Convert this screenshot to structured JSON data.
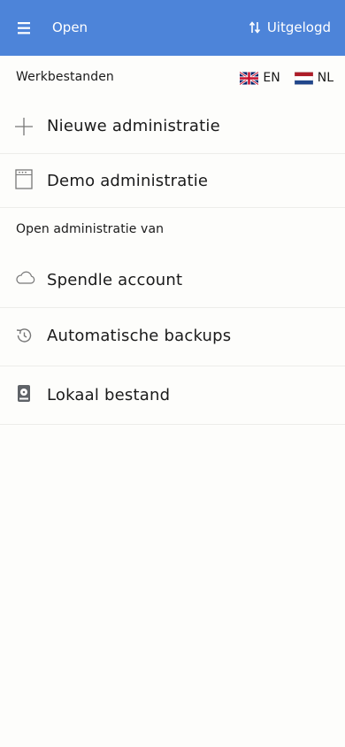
{
  "appbar": {
    "title": "Open",
    "sync_label": "Uitgelogd",
    "background": "#4d84d9"
  },
  "workfiles": {
    "heading": "Werkbestanden",
    "languages": [
      {
        "code": "EN",
        "flag": "uk-flag-icon"
      },
      {
        "code": "NL",
        "flag": "nl-flag-icon"
      }
    ],
    "items": [
      {
        "label": "Nieuwe administratie",
        "icon": "plus-icon"
      },
      {
        "label": "Demo administratie",
        "icon": "document-icon"
      }
    ]
  },
  "open_from": {
    "heading": "Open administratie van",
    "items": [
      {
        "label": "Spendle account",
        "icon": "cloud-icon"
      },
      {
        "label": "Automatische backups",
        "icon": "history-icon"
      },
      {
        "label": "Lokaal bestand",
        "icon": "hard-drive-icon"
      }
    ]
  }
}
